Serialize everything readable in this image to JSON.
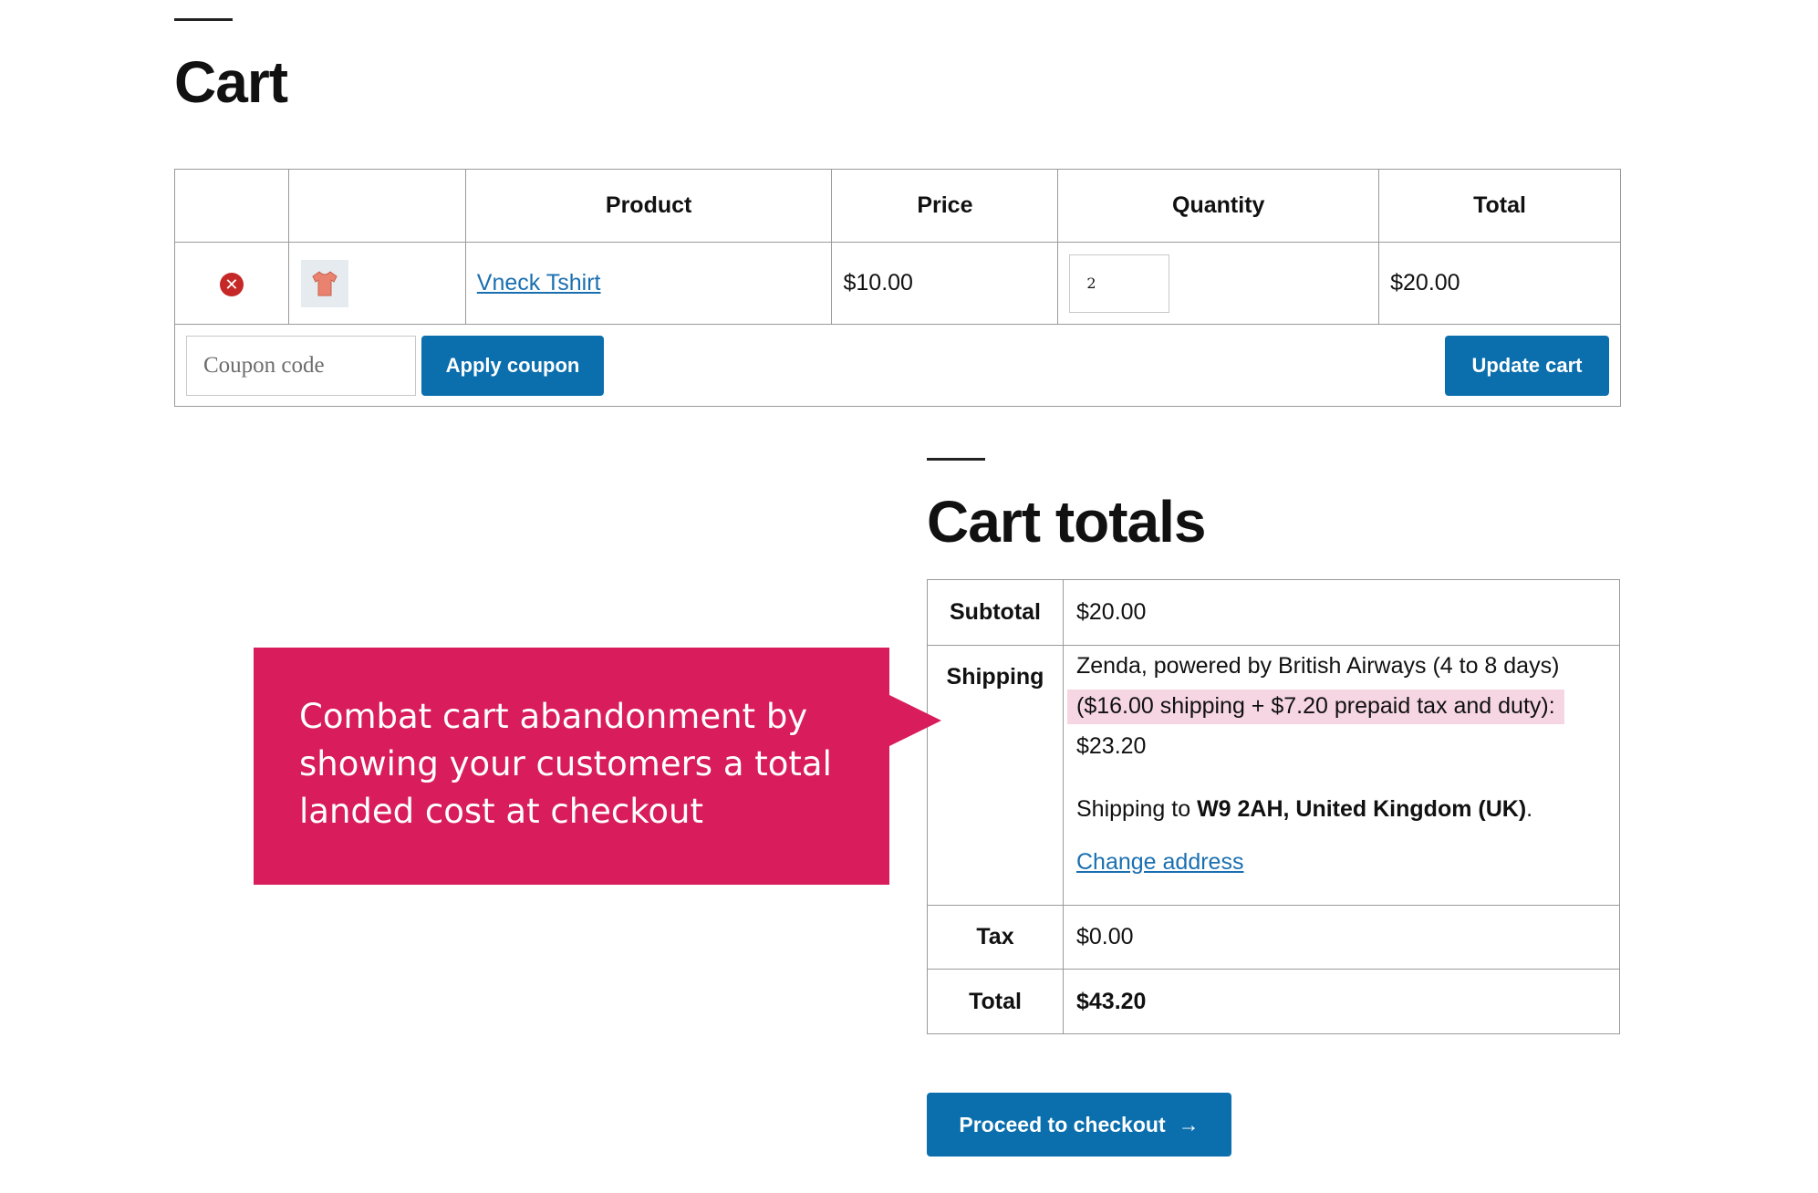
{
  "cart": {
    "title": "Cart",
    "columns": [
      "",
      "",
      "Product",
      "Price",
      "Quantity",
      "Total"
    ],
    "items": [
      {
        "product": "Vneck Tshirt",
        "price": "$10.00",
        "quantity": "2",
        "total": "$20.00",
        "remove_icon": "close-icon",
        "thumbnail": "tshirt-icon"
      }
    ],
    "coupon_placeholder": "Coupon code",
    "apply_coupon_label": "Apply coupon",
    "update_cart_label": "Update cart"
  },
  "totals": {
    "title": "Cart totals",
    "subtotal_label": "Subtotal",
    "subtotal_value": "$20.00",
    "shipping_label": "Shipping",
    "shipping_method": "Zenda, powered by British Airways (4 to 8 days)",
    "shipping_breakdown": "($16.00 shipping + $7.20 prepaid tax and duty):",
    "shipping_cost": "$23.20",
    "shipping_to_prefix": "Shipping to",
    "shipping_to_address": "W9 2AH, United Kingdom (UK)",
    "change_address_label": "Change address",
    "tax_label": "Tax",
    "tax_value": "$0.00",
    "total_label": "Total",
    "total_value": "$43.20"
  },
  "checkout": {
    "label": "Proceed to checkout",
    "arrow": "→"
  },
  "callout": {
    "text": "Combat cart abandonment by showing your customers a total landed cost at checkout"
  },
  "colors": {
    "accent": "#0b6fae",
    "callout": "#d81c5c",
    "highlight": "#f6d6e2",
    "remove": "#c62828"
  }
}
